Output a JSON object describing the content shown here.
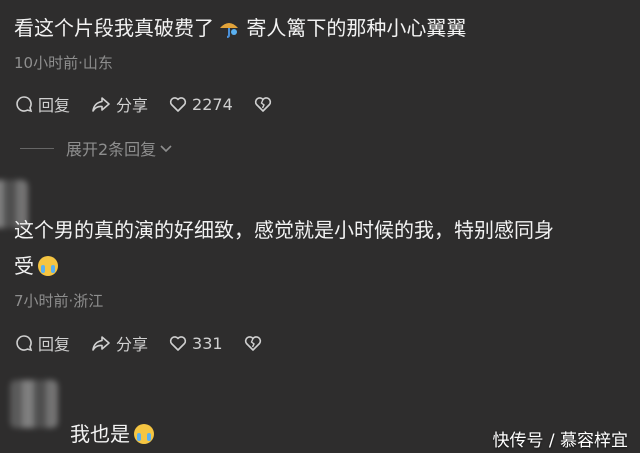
{
  "comments": [
    {
      "text": "看这个片段我真破费了",
      "text_after_emoji": " 寄人篱下的那种小心翼翼",
      "meta": "10小时前·山东",
      "reply_label": "回复",
      "share_label": "分享",
      "like_count": "2274",
      "expand_label": "展开2条回复"
    },
    {
      "text_line1": "这个男的真的演的好细致，感觉就是小时候的我，特别感同身",
      "text_line2": "受",
      "meta": "7小时前·浙江",
      "reply_label": "回复",
      "share_label": "分享",
      "like_count": "331"
    },
    {
      "text": "我也是"
    }
  ],
  "watermark": "快传号 / 慕容梓宜",
  "colors": {
    "background": "#2e2d2d",
    "text": "#f2f2f2",
    "meta": "#8e8e8e"
  }
}
